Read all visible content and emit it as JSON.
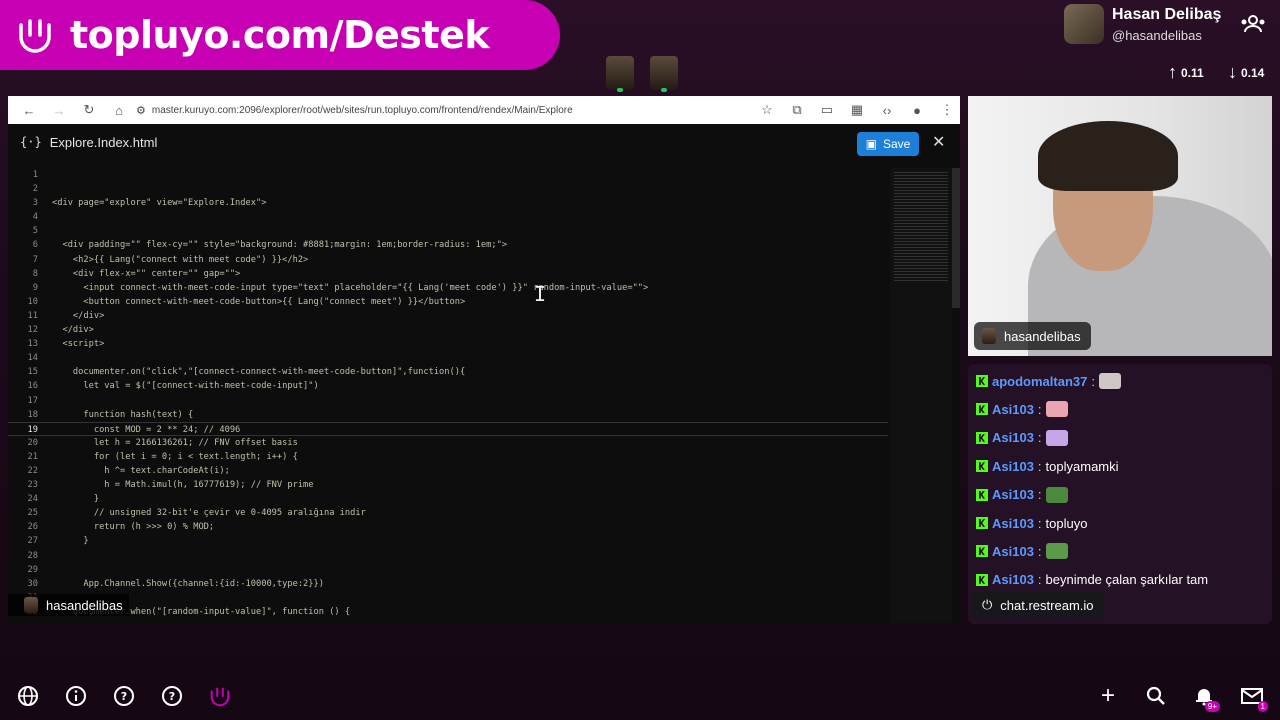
{
  "banner": {
    "text": "topluyo.com/Destek"
  },
  "profile": {
    "name": "Hasan Delibaş",
    "handle": "@hasandelibas"
  },
  "network": {
    "up": "0.11",
    "down": "0.14"
  },
  "browser": {
    "url": "master.kuruyo.com:2096/explorer/root/web/sites/run.topluyo.com/frontend/rendex/Main/Explore"
  },
  "editor": {
    "file_icon": "{·}",
    "file_name": "Explore.Index.html",
    "save_label": "Save",
    "close_label": "✕",
    "lines": [
      "",
      "",
      "<div page=\"explore\" view=\"Explore.Index\">",
      "",
      "",
      "  <div padding=\"\" flex-cy=\"\" style=\"background: #8881;margin: 1em;border-radius: 1em;\">",
      "    <h2>{{ Lang(\"connect with meet code\") }}</h2>",
      "    <div flex-x=\"\" center=\"\" gap=\"\">",
      "      <input connect-with-meet-code-input type=\"text\" placeholder=\"{{ Lang('meet code') }}\" random-input-value=\"\">",
      "      <button connect-with-meet-code-button>{{ Lang(\"connect meet\") }}</button>",
      "    </div>",
      "  </div>",
      "  <script>",
      "",
      "    documenter.on(\"click\",\"[connect-connect-with-meet-code-button]\",function(){",
      "      let val = $(\"[connect-with-meet-code-input]\")",
      "",
      "      function hash(text) {",
      "        const MOD = 2 ** 24; // 4096",
      "        let h = 2166136261; // FNV offset basis",
      "        for (let i = 0; i < text.length; i++) {",
      "          h ^= text.charCodeAt(i);",
      "          h = Math.imul(h, 16777619); // FNV prime",
      "        }",
      "        // unsigned 32-bit'e çevir ve 0-4095 aralığına indir",
      "        return (h >>> 0) % MOD;",
      "      }",
      "",
      "",
      "      App.Channel.Show({channel:{id:-10000,type:2}})",
      "",
      "    documenter.when(\"[random-input-value]\", function () {"
    ]
  },
  "overlay_user": "hasandelibas",
  "webcam": {
    "label": "hasandelibas"
  },
  "chat": {
    "messages": [
      {
        "user": "apodomaltan37",
        "text": "",
        "emote": "cat-emote",
        "emote_color": "#cfc6c6"
      },
      {
        "user": "Asi103",
        "text": "",
        "emote": "pink-emote",
        "emote_color": "#e9a6b0"
      },
      {
        "user": "Asi103",
        "text": "",
        "emote": "ghost-emote",
        "emote_color": "#c6a6e6"
      },
      {
        "user": "Asi103",
        "text": "toplyamamki",
        "emote": "",
        "emote_color": ""
      },
      {
        "user": "Asi103",
        "text": "",
        "emote": "frog-emote",
        "emote_color": "#4b8a3d"
      },
      {
        "user": "Asi103",
        "text": "topluyo",
        "emote": "",
        "emote_color": ""
      },
      {
        "user": "Asi103",
        "text": "",
        "emote": "frog-emote",
        "emote_color": "#5a9a48"
      },
      {
        "user": "Asi103",
        "text": "beynimde çalan şarkılar tam",
        "emote": "",
        "emote_color": ""
      }
    ],
    "source": "chat.restream.io"
  },
  "notifications": {
    "badge": "9+",
    "mail_badge": "1"
  },
  "colors": {
    "accent": "#c800b4",
    "save": "#1e7fd8",
    "kick": "#53fc18",
    "chat_user": "#5b9bff"
  }
}
